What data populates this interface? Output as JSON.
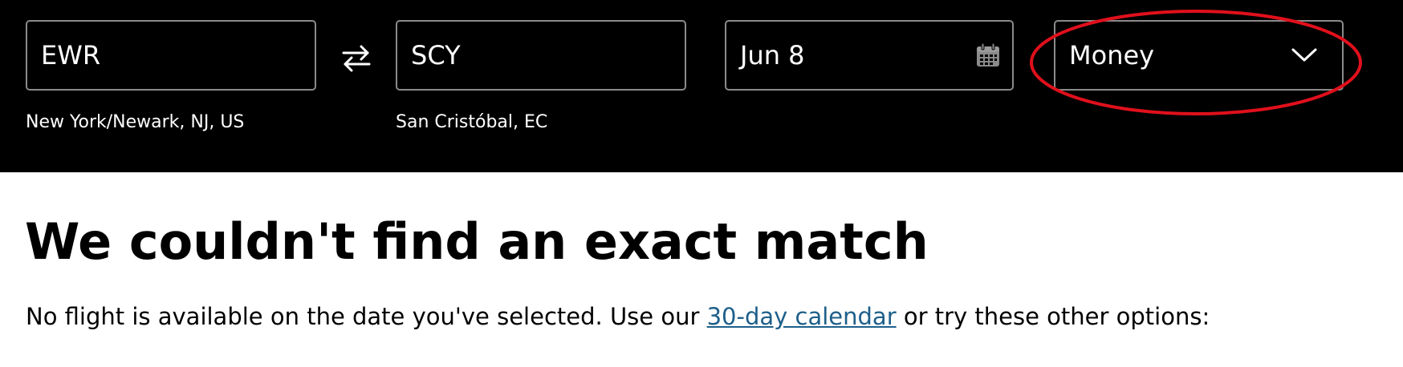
{
  "search": {
    "origin": {
      "code": "EWR",
      "city": "New York/Newark, NJ, US"
    },
    "destination": {
      "code": "SCY",
      "city": "San Cristóbal, EC"
    },
    "date": "Jun 8",
    "fare_type": "Money",
    "swap_icon": "swap-arrows-icon",
    "calendar_icon": "calendar-icon",
    "dropdown_icon": "chevron-down-icon"
  },
  "annotation": {
    "color": "#e0101c"
  },
  "results": {
    "headline": "We couldn't find an exact match",
    "message_before": "No flight is available on the date you've selected. Use our ",
    "calendar_link": "30-day calendar",
    "message_after": " or try these other options:"
  },
  "colors": {
    "header_bg": "#000000",
    "field_border": "#8a8a8a",
    "link": "#1d5f8a"
  }
}
